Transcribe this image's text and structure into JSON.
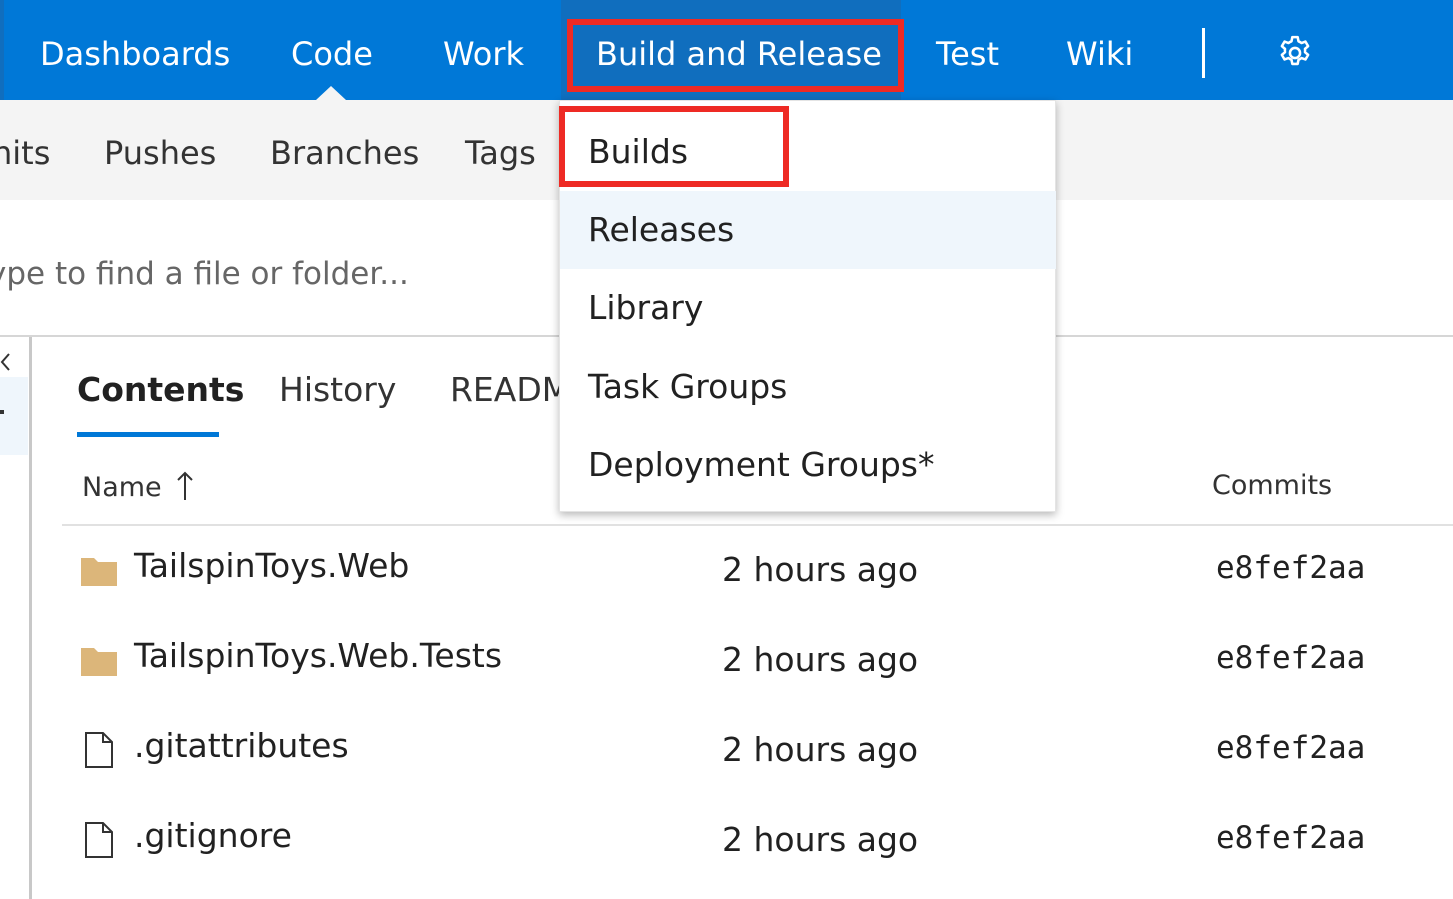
{
  "topnav": {
    "items": [
      {
        "label": "Dashboards"
      },
      {
        "label": "Code"
      },
      {
        "label": "Work"
      },
      {
        "label": "Build and Release"
      },
      {
        "label": "Test"
      },
      {
        "label": "Wiki"
      }
    ],
    "settings_icon": "gear-icon"
  },
  "subnav": {
    "items": [
      {
        "label": "nits"
      },
      {
        "label": "Pushes"
      },
      {
        "label": "Branches"
      },
      {
        "label": "Tags"
      }
    ]
  },
  "search": {
    "placeholder": "ype to find a file or folder..."
  },
  "tabs": [
    {
      "label": "Contents",
      "active": true
    },
    {
      "label": "History"
    },
    {
      "label": "READM"
    }
  ],
  "table": {
    "columns": {
      "name": "Name",
      "commits": "Commits"
    },
    "sort_icon": "sort-up-arrow-icon",
    "rows": [
      {
        "icon": "folder-icon",
        "name": "TailspinToys.Web",
        "date": "2 hours ago",
        "commit": "e8fef2aa"
      },
      {
        "icon": "folder-icon",
        "name": "TailspinToys.Web.Tests",
        "date": "2 hours ago",
        "commit": "e8fef2aa"
      },
      {
        "icon": "file-icon",
        "name": ".gitattributes",
        "date": "2 hours ago",
        "commit": "e8fef2aa"
      },
      {
        "icon": "file-icon",
        "name": ".gitignore",
        "date": "2 hours ago",
        "commit": "e8fef2aa"
      }
    ]
  },
  "dropdown": {
    "items": [
      {
        "label": "Builds"
      },
      {
        "label": "Releases"
      },
      {
        "label": "Library"
      },
      {
        "label": "Task Groups"
      },
      {
        "label": "Deployment Groups*"
      }
    ]
  },
  "colors": {
    "nav_blue": "#0078d7",
    "nav_active": "#106ebe",
    "highlight_red": "#ee2a24",
    "folder": "#dcb67a",
    "hover_bg": "#eff6fc"
  }
}
